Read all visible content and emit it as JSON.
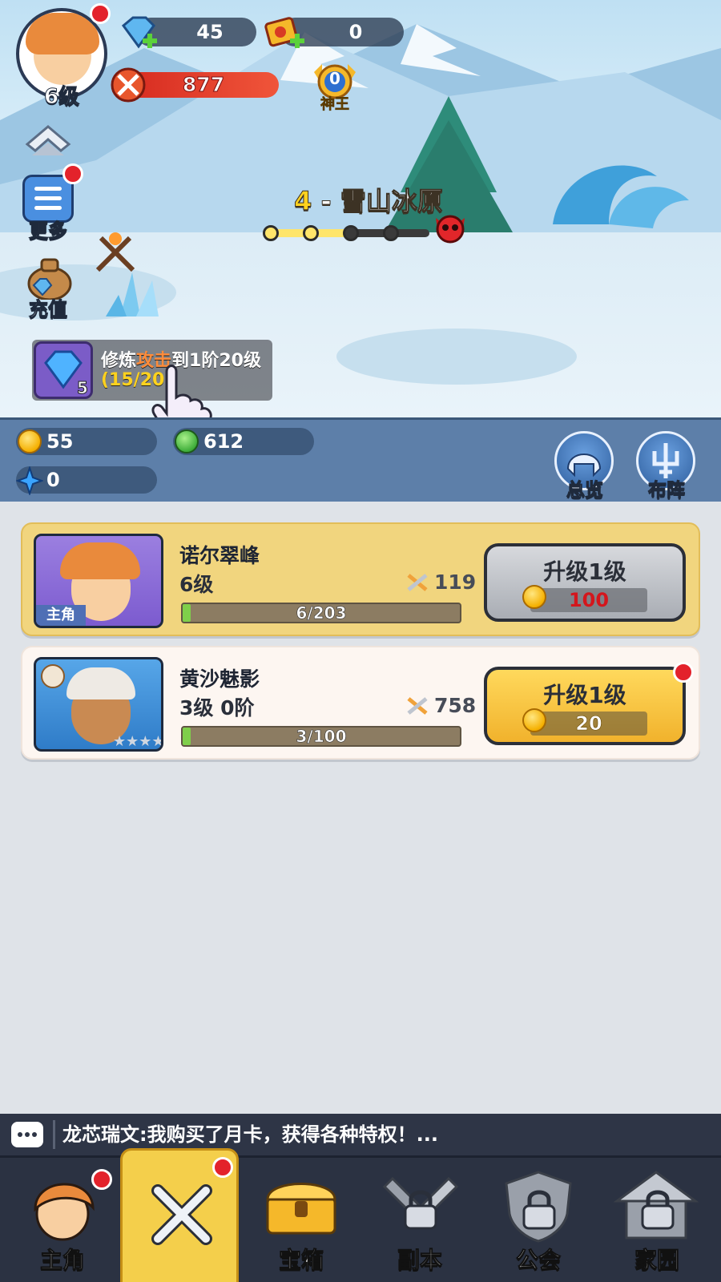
{
  "player": {
    "level": "6级",
    "gems": "45",
    "tickets": "0",
    "power": "877",
    "rank_value": "0",
    "rank_label": "神王"
  },
  "side_menu": {
    "more": "更多",
    "recharge": "充值"
  },
  "stage": {
    "number": "4",
    "separator": " - ",
    "name": "雪山冰原",
    "progress_nodes_done": 3,
    "progress_nodes_total": 4
  },
  "tip": {
    "prefix": "修炼",
    "highlight": "攻击",
    "suffix": "到1阶20级",
    "progress": "(15/20)",
    "gem_count": "5"
  },
  "currencies": {
    "gold": "55",
    "green": "612",
    "crystal": "0"
  },
  "round_buttons": {
    "overview": "总览",
    "formation": "布阵"
  },
  "heroes": [
    {
      "name": "诺尔翠峰",
      "level": "6级",
      "power": "119",
      "xp_text": "6/203",
      "xp_fraction": 0.03,
      "tag": "主角",
      "button_label": "升级1级",
      "cost": "100"
    },
    {
      "name": "黄沙魅影",
      "level": "3级 0阶",
      "power": "758",
      "xp_text": "3/100",
      "xp_fraction": 0.03,
      "tag": "",
      "button_label": "升级1级",
      "cost": "20"
    }
  ],
  "chat": {
    "message": "龙芯瑞文:我购买了月卡，获得各种特权！..."
  },
  "nav": {
    "hero": "主角",
    "chest": "宝箱",
    "dungeon": "副本",
    "guild": "公会",
    "home": "家园"
  },
  "colors": {
    "accent_gold": "#f4cf4b",
    "notify_red": "#e3222b",
    "strip_blue": "#5d7fa9"
  }
}
